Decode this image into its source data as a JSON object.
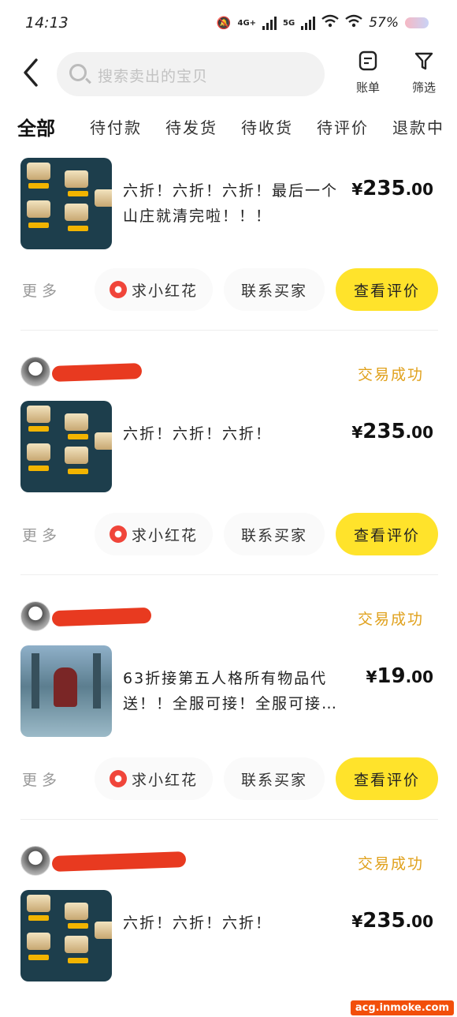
{
  "status_bar": {
    "time": "14:13",
    "net_4g": "4G+",
    "net_5g": "5G",
    "battery": "57%"
  },
  "header": {
    "search_placeholder": "搜索卖出的宝贝",
    "bill_label": "账单",
    "filter_label": "筛选"
  },
  "tabs": [
    "全部",
    "待付款",
    "待发货",
    "待收货",
    "待评价",
    "退款中"
  ],
  "actions": {
    "more": "更多",
    "flower": "求小红花",
    "contact": "联系买家",
    "review": "查看评价"
  },
  "orders": [
    {
      "status": "",
      "seller_name": "",
      "title": "六折！六折！六折！最后一个山庄就清完啦！！！",
      "price_symbol": "¥",
      "price_int": "235",
      "price_dec": ".00"
    },
    {
      "status": "交易成功",
      "seller_name": "",
      "title": "六折！六折！六折！",
      "price_symbol": "¥",
      "price_int": "235",
      "price_dec": ".00"
    },
    {
      "status": "交易成功",
      "seller_name": "",
      "title": "63折接第五人格所有物品代送！！全服可接！全服可接…",
      "price_symbol": "¥",
      "price_int": "19",
      "price_dec": ".00"
    },
    {
      "status": "交易成功",
      "seller_name": "",
      "title": "六折！六折！六折！",
      "price_symbol": "¥",
      "price_int": "235",
      "price_dec": ".00"
    }
  ],
  "watermark": "acg.inmoke.com",
  "colors": {
    "accent_yellow": "#ffe32b",
    "status_gold": "#e0a11c",
    "flower_red": "#f0453a"
  }
}
